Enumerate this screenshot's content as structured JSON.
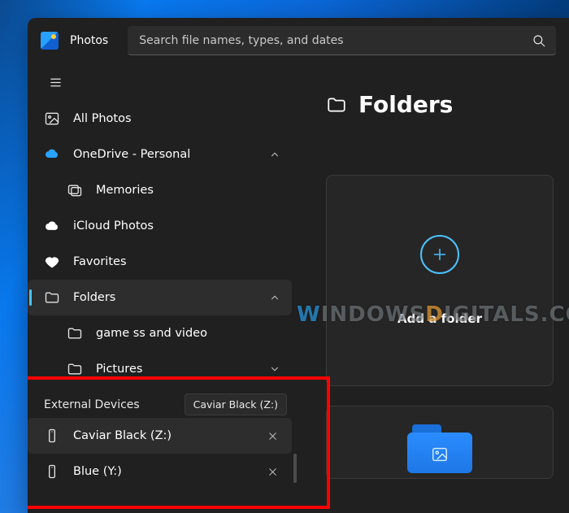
{
  "app_title": "Photos",
  "search_placeholder": "Search file names, types, and dates",
  "sidebar": {
    "all_photos": "All Photos",
    "onedrive": "OneDrive - Personal",
    "memories": "Memories",
    "icloud": "iCloud Photos",
    "favorites": "Favorites",
    "folders": "Folders",
    "folder_game": "game ss and video",
    "folder_pictures": "Pictures"
  },
  "external": {
    "section_label": "External Devices",
    "items": [
      {
        "label": "Caviar Black (Z:)"
      },
      {
        "label": "Blue (Y:)"
      }
    ],
    "tooltip": "Caviar Black (Z:)"
  },
  "content": {
    "title": "Folders",
    "add_tile_label": "Add a folder"
  },
  "watermark_a": "W",
  "watermark_b": "INDOWS",
  "watermark_c": "D",
  "watermark_d": "IGITALS.COM"
}
